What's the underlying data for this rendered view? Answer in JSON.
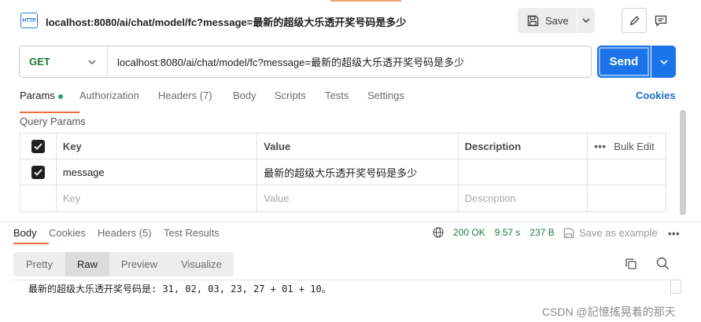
{
  "title": "localhost:8080/ai/chat/model/fc?message=最新的超级大乐透开奖号码是多少",
  "http_icon_text": "HTTP",
  "save_label": "Save",
  "request": {
    "method": "GET",
    "url": "localhost:8080/ai/chat/model/fc?message=最新的超级大乐透开奖号码是多少",
    "send_label": "Send"
  },
  "req_tabs": [
    {
      "label": "Params",
      "active": true
    },
    {
      "label": "Authorization"
    },
    {
      "label": "Headers (7)"
    },
    {
      "label": "Body"
    },
    {
      "label": "Scripts"
    },
    {
      "label": "Tests"
    },
    {
      "label": "Settings"
    }
  ],
  "cookies_label": "Cookies",
  "query_params": {
    "title": "Query Params",
    "headers": {
      "key": "Key",
      "value": "Value",
      "description": "Description",
      "bulk_edit": "Bulk Edit"
    },
    "rows": [
      {
        "key": "message",
        "value": "最新的超级大乐透开奖号码是多少",
        "description": "",
        "checked": true
      }
    ],
    "placeholder": {
      "key": "Key",
      "value": "Value",
      "description": "Description"
    }
  },
  "response": {
    "tabs": [
      "Body",
      "Cookies",
      "Headers (5)",
      "Test Results"
    ],
    "status": "200 OK",
    "time": "9.57 s",
    "size": "237 B",
    "save_example": "Save as example",
    "view_tabs": [
      "Pretty",
      "Raw",
      "Preview",
      "Visualize"
    ],
    "active_view": "Raw",
    "body": "最新的超级大乐透开奖号码是: 31, 02, 03, 23, 27 + 01 + 10。"
  },
  "watermark": "CSDN @記憶搖晃着的那天",
  "colors": {
    "accent": "#f26b3a",
    "primary": "#1a73e8",
    "success": "#1f7a3a"
  }
}
